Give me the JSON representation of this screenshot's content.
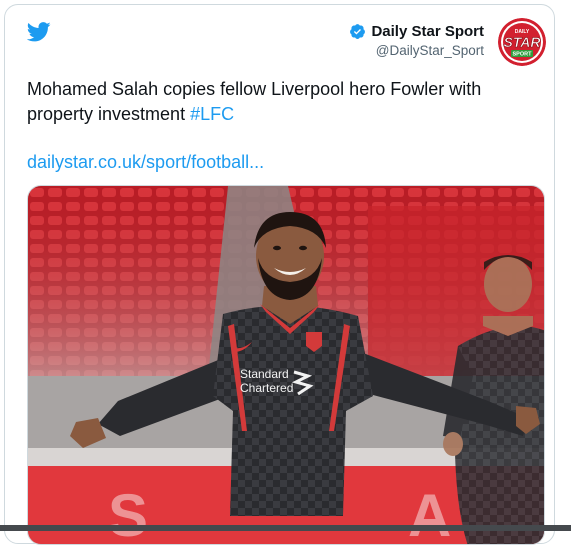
{
  "tweet": {
    "account_name": "Daily Star Sport",
    "handle": "@DailyStar_Sport",
    "avatar_text": {
      "top": "DAILY",
      "middle": "STAR",
      "bottom": "SPORT"
    },
    "text_main": "Mohamed Salah copies fellow Liverpool hero Fowler with property investment ",
    "hashtag": "#LFC",
    "link": "dailystar.co.uk/sport/football...",
    "media": {
      "sponsor_line1": "Standard",
      "sponsor_line2": "Chartered"
    }
  },
  "icons": {
    "platform_logo": "twitter-bird-icon",
    "verified": "verified-badge-icon"
  },
  "colors": {
    "twitter_blue": "#1d9bf0",
    "brand_red": "#d2202f",
    "stadium_red": "#c8242b",
    "kit_dark": "#2b2c30"
  }
}
